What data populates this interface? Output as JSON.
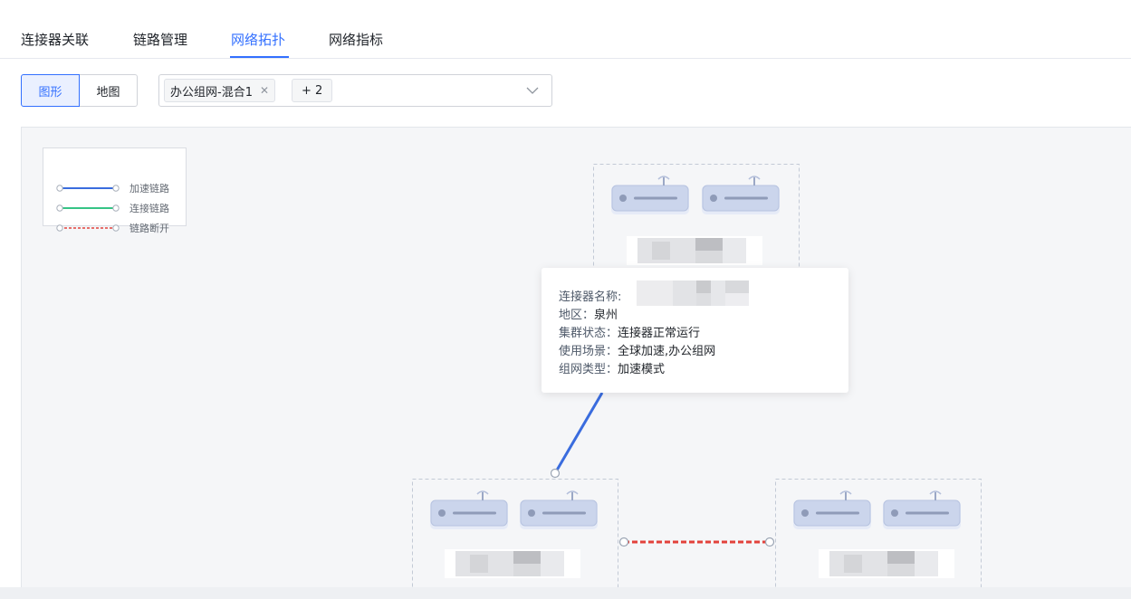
{
  "tabs": [
    {
      "label": "连接器关联"
    },
    {
      "label": "链路管理"
    },
    {
      "label": "网络拓扑"
    },
    {
      "label": "网络指标"
    }
  ],
  "view_toggle": {
    "graph_label": "图形",
    "map_label": "地图"
  },
  "network_select": {
    "selected_tag": "办公组网-混合1",
    "more_tag": "+ 2"
  },
  "legend": [
    {
      "label": "加速链路",
      "color": "#3a6cde"
    },
    {
      "label": "连接链路",
      "color": "#36c486"
    },
    {
      "label": "链路断开",
      "color": "#e2423c"
    }
  ],
  "tooltip": {
    "name_key": "连接器名称:",
    "region_key": "地区：",
    "region_value": "泉州",
    "cluster_key": "集群状态：",
    "cluster_value": "连接器正常运行",
    "scenario_key": "使用场景：",
    "scenario_value": "全球加速,办公组网",
    "type_key": "组网类型：",
    "type_value": "加速模式"
  },
  "colors": {
    "accent": "#3370ff",
    "accel_link": "#3a6cde",
    "broken_link": "#e2423c",
    "device": "#c9d3ea"
  }
}
